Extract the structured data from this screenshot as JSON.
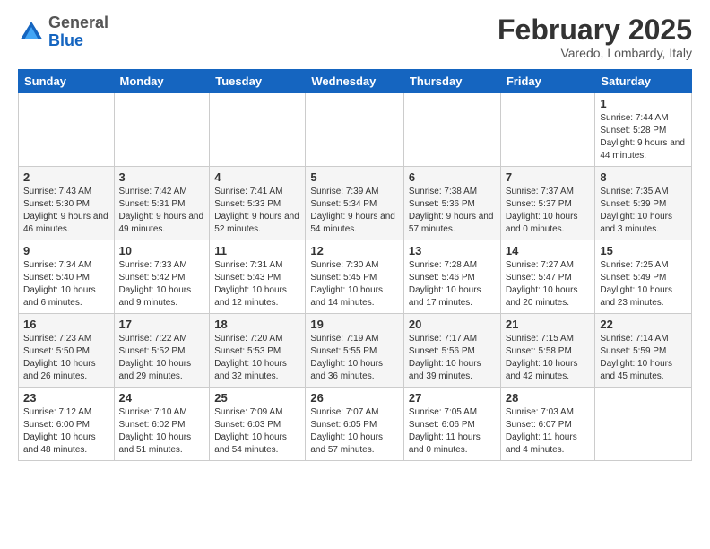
{
  "header": {
    "logo": {
      "general": "General",
      "blue": "Blue"
    },
    "month": "February 2025",
    "location": "Varedo, Lombardy, Italy"
  },
  "weekdays": [
    "Sunday",
    "Monday",
    "Tuesday",
    "Wednesday",
    "Thursday",
    "Friday",
    "Saturday"
  ],
  "weeks": [
    [
      {
        "day": "",
        "info": ""
      },
      {
        "day": "",
        "info": ""
      },
      {
        "day": "",
        "info": ""
      },
      {
        "day": "",
        "info": ""
      },
      {
        "day": "",
        "info": ""
      },
      {
        "day": "",
        "info": ""
      },
      {
        "day": "1",
        "info": "Sunrise: 7:44 AM\nSunset: 5:28 PM\nDaylight: 9 hours and 44 minutes."
      }
    ],
    [
      {
        "day": "2",
        "info": "Sunrise: 7:43 AM\nSunset: 5:30 PM\nDaylight: 9 hours and 46 minutes."
      },
      {
        "day": "3",
        "info": "Sunrise: 7:42 AM\nSunset: 5:31 PM\nDaylight: 9 hours and 49 minutes."
      },
      {
        "day": "4",
        "info": "Sunrise: 7:41 AM\nSunset: 5:33 PM\nDaylight: 9 hours and 52 minutes."
      },
      {
        "day": "5",
        "info": "Sunrise: 7:39 AM\nSunset: 5:34 PM\nDaylight: 9 hours and 54 minutes."
      },
      {
        "day": "6",
        "info": "Sunrise: 7:38 AM\nSunset: 5:36 PM\nDaylight: 9 hours and 57 minutes."
      },
      {
        "day": "7",
        "info": "Sunrise: 7:37 AM\nSunset: 5:37 PM\nDaylight: 10 hours and 0 minutes."
      },
      {
        "day": "8",
        "info": "Sunrise: 7:35 AM\nSunset: 5:39 PM\nDaylight: 10 hours and 3 minutes."
      }
    ],
    [
      {
        "day": "9",
        "info": "Sunrise: 7:34 AM\nSunset: 5:40 PM\nDaylight: 10 hours and 6 minutes."
      },
      {
        "day": "10",
        "info": "Sunrise: 7:33 AM\nSunset: 5:42 PM\nDaylight: 10 hours and 9 minutes."
      },
      {
        "day": "11",
        "info": "Sunrise: 7:31 AM\nSunset: 5:43 PM\nDaylight: 10 hours and 12 minutes."
      },
      {
        "day": "12",
        "info": "Sunrise: 7:30 AM\nSunset: 5:45 PM\nDaylight: 10 hours and 14 minutes."
      },
      {
        "day": "13",
        "info": "Sunrise: 7:28 AM\nSunset: 5:46 PM\nDaylight: 10 hours and 17 minutes."
      },
      {
        "day": "14",
        "info": "Sunrise: 7:27 AM\nSunset: 5:47 PM\nDaylight: 10 hours and 20 minutes."
      },
      {
        "day": "15",
        "info": "Sunrise: 7:25 AM\nSunset: 5:49 PM\nDaylight: 10 hours and 23 minutes."
      }
    ],
    [
      {
        "day": "16",
        "info": "Sunrise: 7:23 AM\nSunset: 5:50 PM\nDaylight: 10 hours and 26 minutes."
      },
      {
        "day": "17",
        "info": "Sunrise: 7:22 AM\nSunset: 5:52 PM\nDaylight: 10 hours and 29 minutes."
      },
      {
        "day": "18",
        "info": "Sunrise: 7:20 AM\nSunset: 5:53 PM\nDaylight: 10 hours and 32 minutes."
      },
      {
        "day": "19",
        "info": "Sunrise: 7:19 AM\nSunset: 5:55 PM\nDaylight: 10 hours and 36 minutes."
      },
      {
        "day": "20",
        "info": "Sunrise: 7:17 AM\nSunset: 5:56 PM\nDaylight: 10 hours and 39 minutes."
      },
      {
        "day": "21",
        "info": "Sunrise: 7:15 AM\nSunset: 5:58 PM\nDaylight: 10 hours and 42 minutes."
      },
      {
        "day": "22",
        "info": "Sunrise: 7:14 AM\nSunset: 5:59 PM\nDaylight: 10 hours and 45 minutes."
      }
    ],
    [
      {
        "day": "23",
        "info": "Sunrise: 7:12 AM\nSunset: 6:00 PM\nDaylight: 10 hours and 48 minutes."
      },
      {
        "day": "24",
        "info": "Sunrise: 7:10 AM\nSunset: 6:02 PM\nDaylight: 10 hours and 51 minutes."
      },
      {
        "day": "25",
        "info": "Sunrise: 7:09 AM\nSunset: 6:03 PM\nDaylight: 10 hours and 54 minutes."
      },
      {
        "day": "26",
        "info": "Sunrise: 7:07 AM\nSunset: 6:05 PM\nDaylight: 10 hours and 57 minutes."
      },
      {
        "day": "27",
        "info": "Sunrise: 7:05 AM\nSunset: 6:06 PM\nDaylight: 11 hours and 0 minutes."
      },
      {
        "day": "28",
        "info": "Sunrise: 7:03 AM\nSunset: 6:07 PM\nDaylight: 11 hours and 4 minutes."
      },
      {
        "day": "",
        "info": ""
      }
    ]
  ]
}
